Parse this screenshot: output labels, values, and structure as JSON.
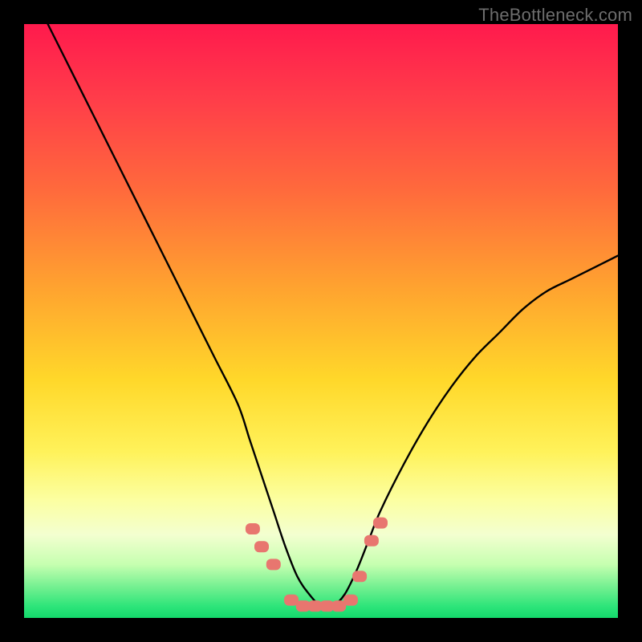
{
  "watermark": "TheBottleneck.com",
  "chart_data": {
    "type": "line",
    "title": "",
    "xlabel": "",
    "ylabel": "",
    "xlim": [
      0,
      100
    ],
    "ylim": [
      0,
      100
    ],
    "series": [
      {
        "name": "curve",
        "x": [
          4,
          8,
          12,
          16,
          20,
          24,
          28,
          32,
          36,
          38,
          40,
          42,
          44,
          46,
          48,
          50,
          52,
          54,
          56,
          58,
          60,
          64,
          68,
          72,
          76,
          80,
          84,
          88,
          92,
          96,
          100
        ],
        "y": [
          100,
          92,
          84,
          76,
          68,
          60,
          52,
          44,
          36,
          30,
          24,
          18,
          12,
          7,
          4,
          2,
          2,
          4,
          8,
          13,
          18,
          26,
          33,
          39,
          44,
          48,
          52,
          55,
          57,
          59,
          61
        ]
      }
    ],
    "markers": {
      "x": [
        38.5,
        40,
        42,
        45,
        47,
        49,
        51,
        53,
        55,
        56.5,
        58.5,
        60
      ],
      "y": [
        15,
        12,
        9,
        3,
        2,
        2,
        2,
        2,
        3,
        7,
        13,
        16
      ],
      "shape": "rounded-rect",
      "color": "#e8766f"
    },
    "background_gradient": {
      "stops": [
        {
          "pos": 0.0,
          "color": "#ff1a4d"
        },
        {
          "pos": 0.28,
          "color": "#ff6a3c"
        },
        {
          "pos": 0.6,
          "color": "#ffd82a"
        },
        {
          "pos": 0.86,
          "color": "#f3ffd0"
        },
        {
          "pos": 1.0,
          "color": "#14d96c"
        }
      ]
    }
  }
}
